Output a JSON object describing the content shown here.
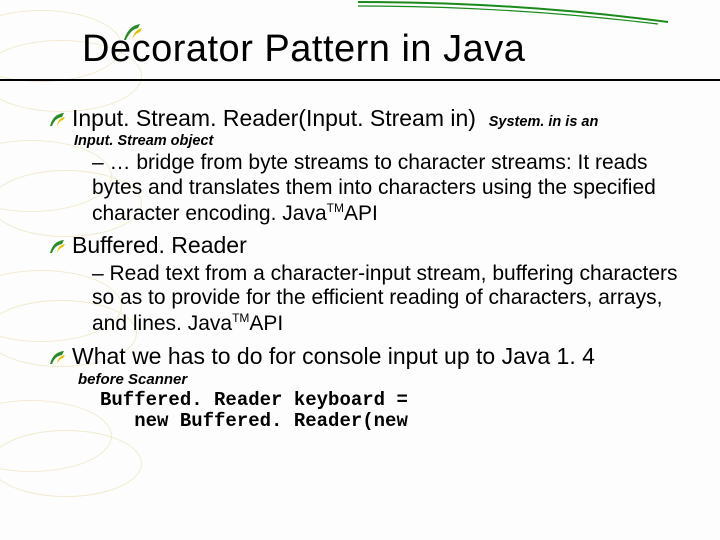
{
  "title": "Decorator Pattern in Java",
  "bullets": [
    {
      "main": "Input. Stream. Reader(Input. Stream in)",
      "annot": "System. in is an",
      "subnote": "Input. Stream object",
      "sub": "– … bridge from byte streams to character streams: It reads bytes and translates them into characters using the specified character encoding.  Java",
      "sub_sup": "TM",
      "sub_tail": "API"
    },
    {
      "main": "Buffered. Reader",
      "sub": "– Read text from a character-input stream, buffering characters so as to provide for the efficient reading of characters, arrays, and lines. Java",
      "sub_sup": "TM",
      "sub_tail": "API"
    },
    {
      "main": "What we has to do for console input up to Java 1. 4",
      "before": "before Scanner",
      "code": "Buffered. Reader keyboard =\n   new Buffered. Reader(new"
    }
  ]
}
